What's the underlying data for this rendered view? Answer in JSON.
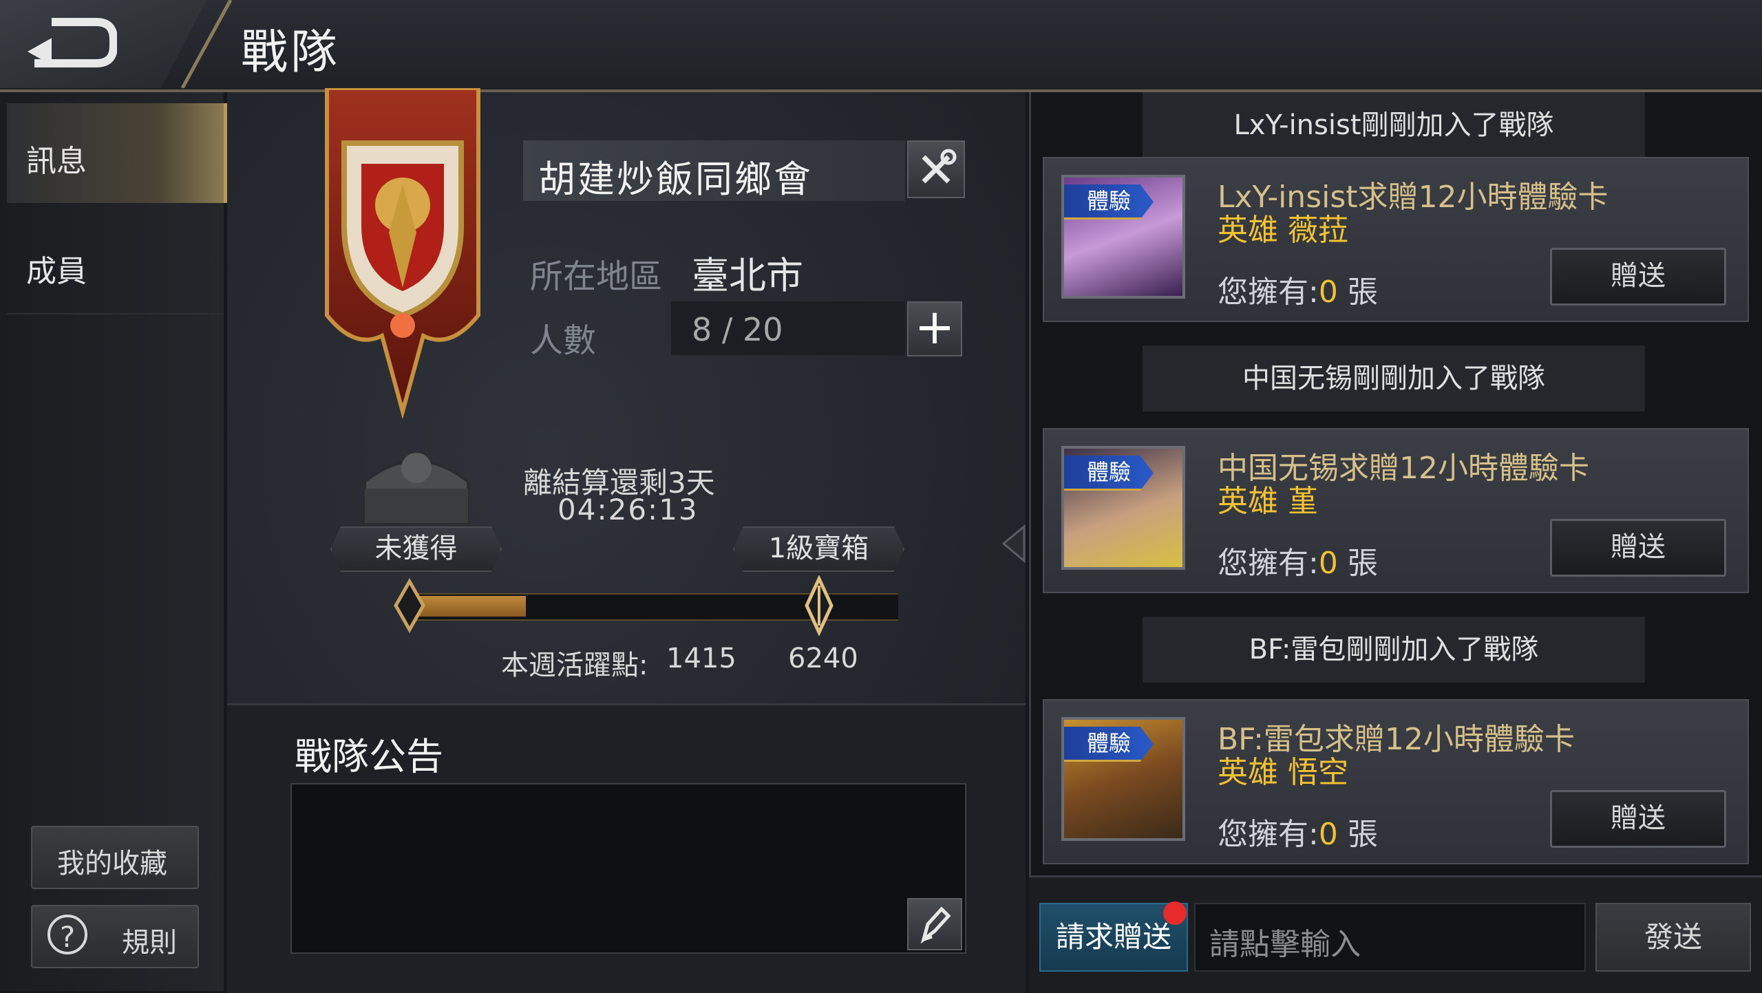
{
  "header": {
    "title": "戰隊"
  },
  "sidebar": {
    "items": [
      {
        "label": "訊息",
        "active": true
      },
      {
        "label": "成員",
        "active": false
      }
    ],
    "favorites_label": "我的收藏",
    "rules_label": "規則"
  },
  "team": {
    "name": "胡建炒飯同鄉會",
    "region_label": "所在地區",
    "region_value": "臺北市",
    "members_label": "人數",
    "members_value": "8 / 20"
  },
  "reward": {
    "status_label": "未獲得",
    "chest_label": "1級寶箱",
    "countdown_label": "離結算還剩3天",
    "countdown_time": "04:26:13",
    "activity_label": "本週活躍點:",
    "activity_value": "1415",
    "activity_max": "6240",
    "progress_fraction": 0.227
  },
  "notice": {
    "title": "戰隊公告",
    "content": ""
  },
  "chat": {
    "system_messages": [
      "LxY-insist剛剛加入了戰隊",
      "中国无锡剛剛加入了戰隊",
      "BF:雷包剛剛加入了戰隊"
    ],
    "requests": [
      {
        "badge": "體驗",
        "line1": "LxY-insist求贈12小時體驗卡",
        "hero": "英雄 薇菈",
        "own_prefix": "您擁有:",
        "own_count": "0",
        "own_suffix": " 張",
        "button": "贈送"
      },
      {
        "badge": "體驗",
        "line1": "中国无锡求贈12小時體驗卡",
        "hero": "英雄 堇",
        "own_prefix": "您擁有:",
        "own_count": "0",
        "own_suffix": " 張",
        "button": "贈送"
      },
      {
        "badge": "體驗",
        "line1": "BF:雷包求贈12小時體驗卡",
        "hero": "英雄 悟空",
        "own_prefix": "您擁有:",
        "own_count": "0",
        "own_suffix": " 張",
        "button": "贈送"
      }
    ]
  },
  "input_bar": {
    "request_label": "請求贈送",
    "placeholder": "請點擊輸入",
    "send_label": "發送"
  },
  "colors": {
    "accent_gold": "#f2c230",
    "request_blue": "#1f4f6a",
    "notification_red": "#e82a2a"
  }
}
